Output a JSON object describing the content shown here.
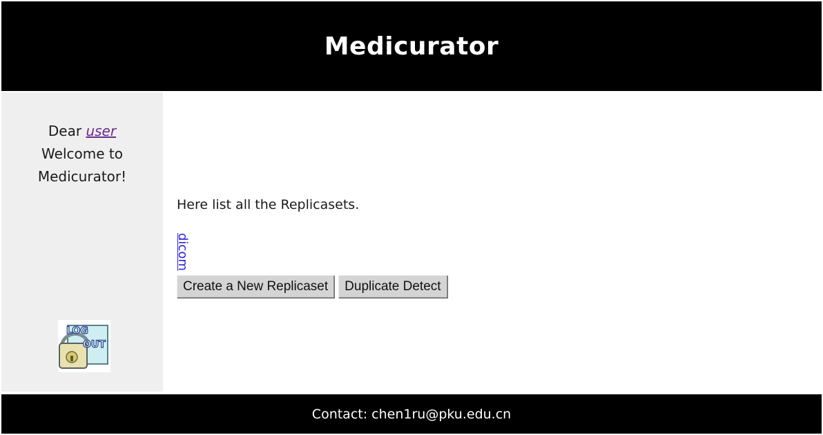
{
  "header": {
    "title": "Medicurator"
  },
  "sidebar": {
    "greeting_prefix": "Dear",
    "username": "user",
    "welcome_line1": "Welcome to",
    "welcome_line2": "Medicurator!",
    "logout_icon": "logout-padlock-icon",
    "logout_text": "LOG OUT"
  },
  "main": {
    "intro_text": "Here list all the Replicasets.",
    "replicaset_link": "dicom",
    "create_button_label": "Create a New Replicaset",
    "detect_button_label": "Duplicate Detect"
  },
  "footer": {
    "contact_text": "Contact: chen1ru@pku.edu.cn"
  },
  "colors": {
    "header_bg": "#000000",
    "sidebar_bg": "#efefef",
    "link_visited": "#6a2a8f",
    "link": "#2b22d8",
    "button_bg": "#d4d4d4"
  }
}
